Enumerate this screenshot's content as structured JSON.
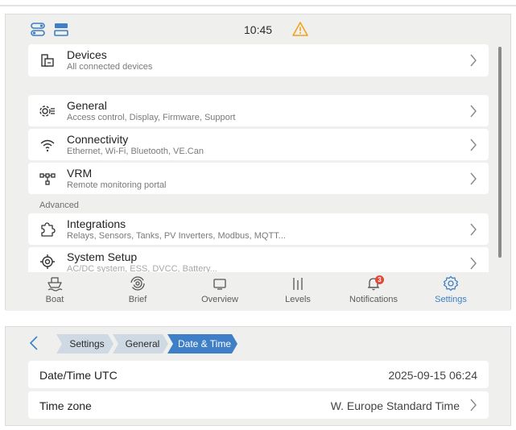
{
  "status_bar": {
    "time": "10:45"
  },
  "main_list": {
    "devices": {
      "title": "Devices",
      "subtitle": "All connected devices"
    },
    "general": {
      "title": "General",
      "subtitle": "Access control, Display, Firmware, Support"
    },
    "connectivity": {
      "title": "Connectivity",
      "subtitle": "Ethernet, Wi-Fi, Bluetooth, VE.Can"
    },
    "vrm": {
      "title": "VRM",
      "subtitle": "Remote monitoring portal"
    },
    "advanced_label": "Advanced",
    "integrations": {
      "title": "Integrations",
      "subtitle": "Relays, Sensors, Tanks, PV Inverters, Modbus, MQTT..."
    },
    "system_setup": {
      "title": "System Setup",
      "subtitle": "AC/DC system, ESS, DVCC, Battery..."
    }
  },
  "navbar": {
    "items": [
      {
        "label": "Boat",
        "icon": "boat-icon"
      },
      {
        "label": "Brief",
        "icon": "brief-icon"
      },
      {
        "label": "Overview",
        "icon": "overview-icon"
      },
      {
        "label": "Levels",
        "icon": "levels-icon"
      },
      {
        "label": "Notifications",
        "icon": "bell-icon",
        "badge": "3"
      },
      {
        "label": "Settings",
        "icon": "gear-icon",
        "active": true
      }
    ]
  },
  "breadcrumb": {
    "items": [
      "Settings",
      "General",
      "Date & Time"
    ]
  },
  "date_time": {
    "utc_label": "Date/Time UTC",
    "utc_value": "2025-09-15 06:24",
    "tz_label": "Time zone",
    "tz_value": "W. Europe Standard Time"
  },
  "colors": {
    "accent": "#3f7fc7",
    "warning": "#f0a21a",
    "badge": "#e0483a",
    "panel_bg": "#efefee"
  }
}
